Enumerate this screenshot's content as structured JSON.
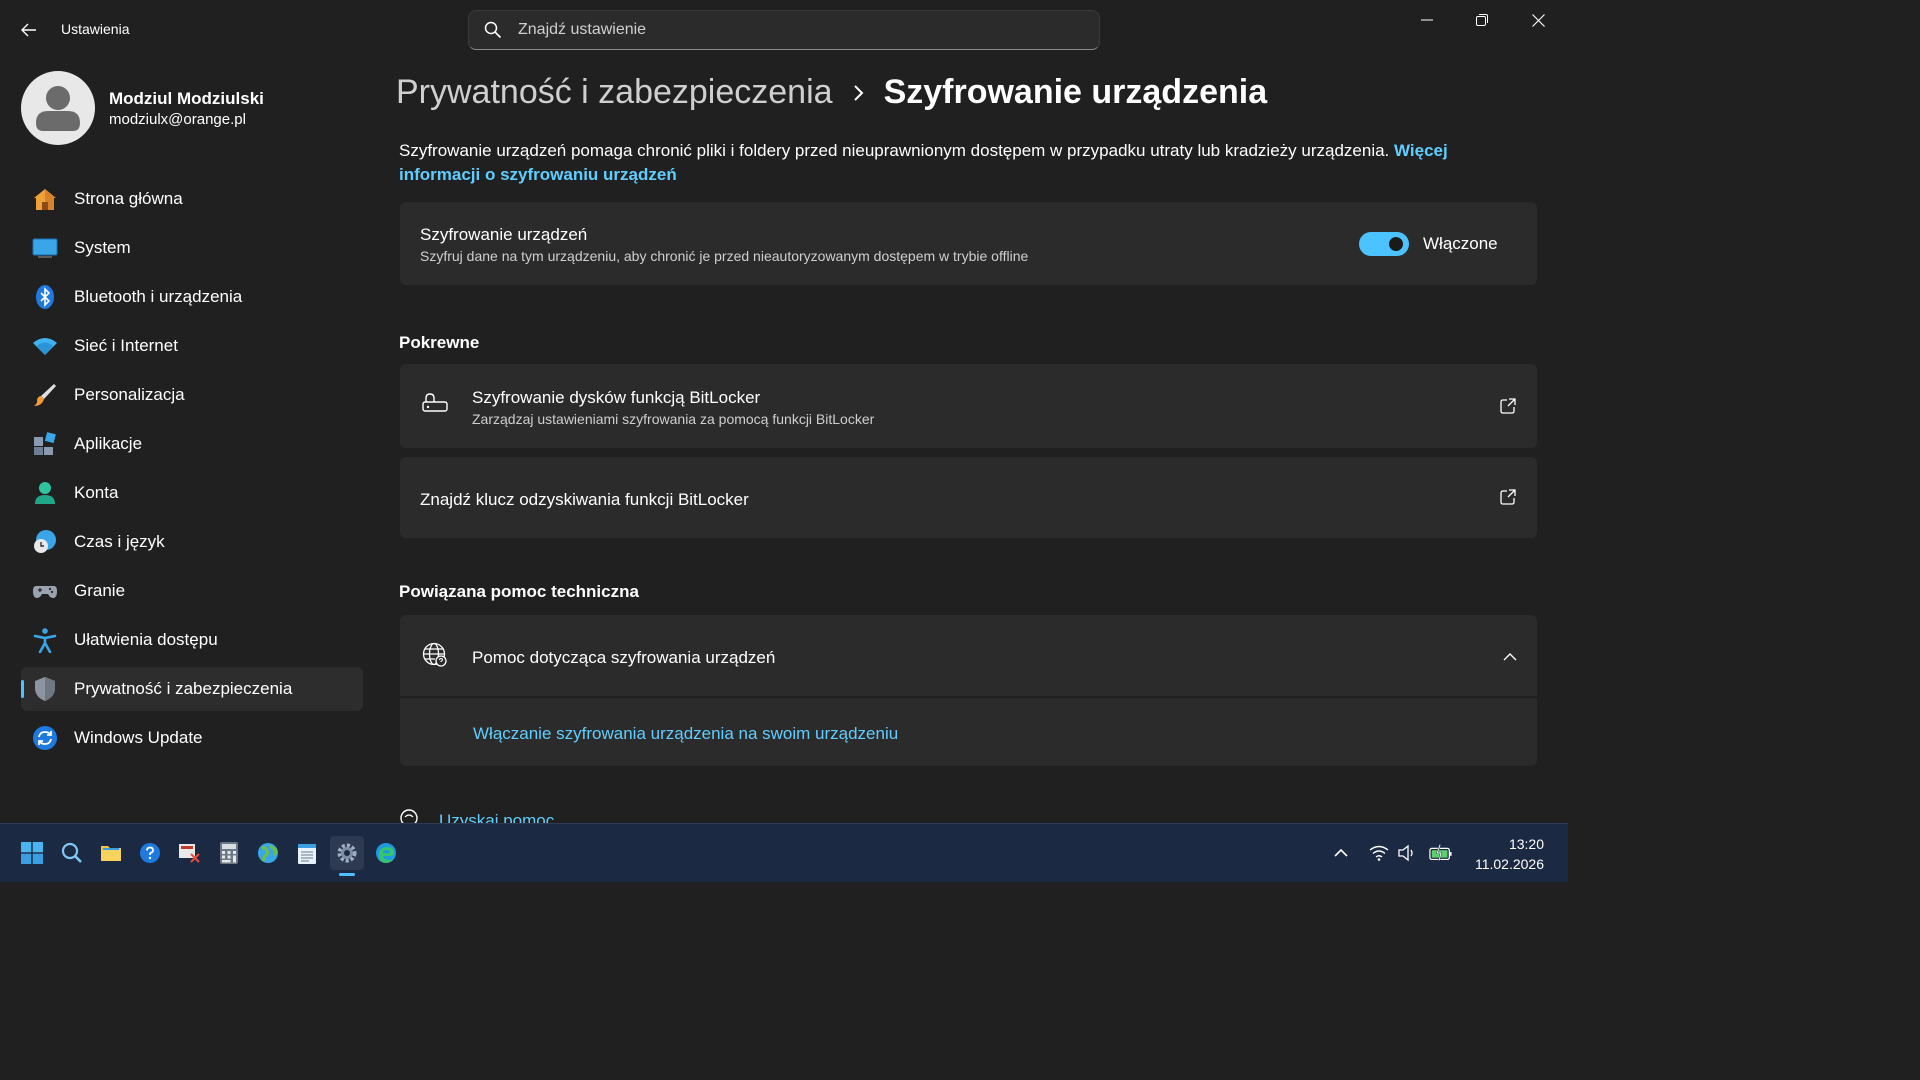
{
  "window": {
    "title": "Ustawienia"
  },
  "search": {
    "placeholder": "Znajdź ustawienie"
  },
  "profile": {
    "name": "Modziul Modziulski",
    "email": "modziulx@orange.pl"
  },
  "sidebar": {
    "items": [
      {
        "label": "Strona główna",
        "icon": "home-icon"
      },
      {
        "label": "System",
        "icon": "monitor-icon"
      },
      {
        "label": "Bluetooth i urządzenia",
        "icon": "bluetooth-icon"
      },
      {
        "label": "Sieć i Internet",
        "icon": "wifi-icon"
      },
      {
        "label": "Personalizacja",
        "icon": "brush-icon"
      },
      {
        "label": "Aplikacje",
        "icon": "apps-icon"
      },
      {
        "label": "Konta",
        "icon": "person-icon"
      },
      {
        "label": "Czas i język",
        "icon": "clock-globe-icon"
      },
      {
        "label": "Granie",
        "icon": "gamepad-icon"
      },
      {
        "label": "Ułatwienia dostępu",
        "icon": "accessibility-icon"
      },
      {
        "label": "Prywatność i zabezpieczenia",
        "icon": "shield-icon",
        "active": true
      },
      {
        "label": "Windows Update",
        "icon": "update-icon"
      }
    ]
  },
  "main": {
    "breadcrumb_parent": "Prywatność i zabezpieczenia",
    "breadcrumb_current": "Szyfrowanie urządzenia",
    "description": "Szyfrowanie urządzeń pomaga chronić pliki i foldery przed nieuprawnionym dostępem w przypadku utraty lub kradzieży urządzenia.",
    "description_link": "Więcej informacji o szyfrowaniu urządzeń",
    "encryption": {
      "title": "Szyfrowanie urządzeń",
      "subtitle": "Szyfruj dane na tym urządzeniu, aby chronić je przed nieautoryzowanym dostępem w trybie offline",
      "toggle_label": "Włączone",
      "toggle_on": true
    },
    "related_heading": "Pokrewne",
    "bitlocker": {
      "title": "Szyfrowanie dysków funkcją BitLocker",
      "subtitle": "Zarządzaj ustawieniami szyfrowania za pomocą funkcji BitLocker"
    },
    "recovery_key": {
      "title": "Znajdź klucz odzyskiwania funkcji BitLocker"
    },
    "support_heading": "Powiązana pomoc techniczna",
    "help": {
      "title": "Pomoc dotycząca szyfrowania urządzeń",
      "link": "Włączanie szyfrowania urządzenia na swoim urządzeniu"
    },
    "get_help": "Uzyskaj pomoc"
  },
  "taskbar": {
    "time": "13:20",
    "date": "11.02.2026",
    "accent": "#4cc2ff"
  }
}
